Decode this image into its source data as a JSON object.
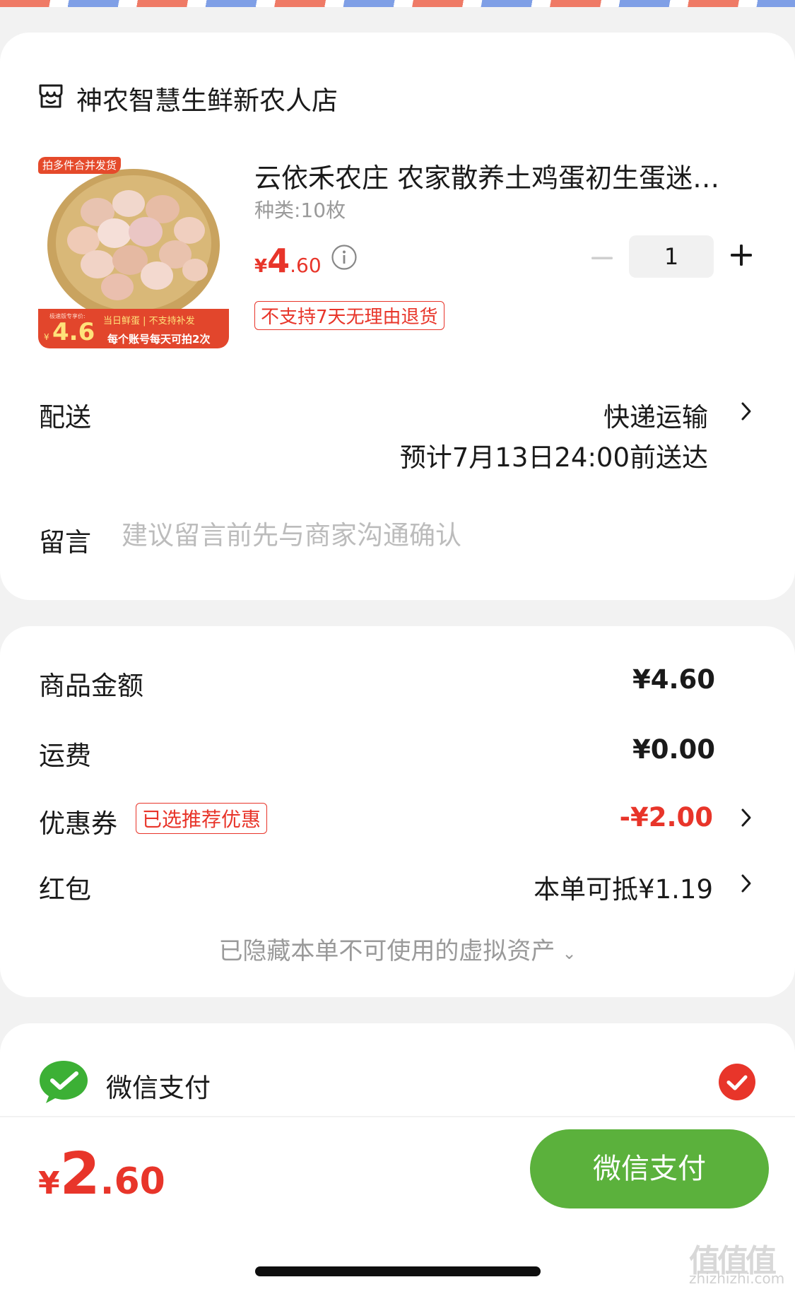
{
  "shop": {
    "name": "神农智慧生鲜新农人店"
  },
  "product": {
    "image_tag": "拍多件合并发货",
    "image_promo": {
      "tiny": "极速版专享价:",
      "price": "4.6",
      "yen": "¥",
      "line1": "当日鲜蛋 | 不支持补发",
      "line2": "每个账号每天可拍2次"
    },
    "title": "云依禾农庄 农家散养土鸡蛋初生蛋迷…",
    "spec": "种类:10枚",
    "price_symbol": "¥",
    "price_int": "4",
    "price_dec": ".60",
    "quantity": "1",
    "return_policy": "不支持7天无理由退货"
  },
  "delivery": {
    "label": "配送",
    "method": "快递运输",
    "eta": "预计7月13日24:00前送达"
  },
  "message": {
    "label": "留言",
    "placeholder": "建议留言前先与商家沟通确认"
  },
  "summary": {
    "goods_label": "商品金额",
    "goods_value": "¥4.60",
    "shipping_label": "运费",
    "shipping_value": "¥0.00",
    "coupon_label": "优惠券",
    "coupon_tag": "已选推荐优惠",
    "coupon_value": "-¥2.00",
    "redpacket_label": "红包",
    "redpacket_value": "本单可抵¥1.19",
    "hidden_assets": "已隐藏本单不可使用的虚拟资产",
    "hidden_caret": "⌄"
  },
  "payment": {
    "method": "微信支付",
    "total_symbol": "¥",
    "total_int": "2",
    "total_dec": ".60",
    "pay_button": "微信支付"
  },
  "watermark": {
    "main": "值值值",
    "sub": "zhizhizhi.com"
  },
  "colors": {
    "accent_red": "#e8352a",
    "wechat_green": "#5bb13c",
    "background": "#f2f2f2"
  },
  "icons": {
    "shop": "shop-icon",
    "info": "info-icon",
    "minus": "minus-icon",
    "plus": "plus-icon",
    "chevron": "chevron-right-icon",
    "wechat": "wechat-pay-icon",
    "check": "check-circle-icon"
  }
}
